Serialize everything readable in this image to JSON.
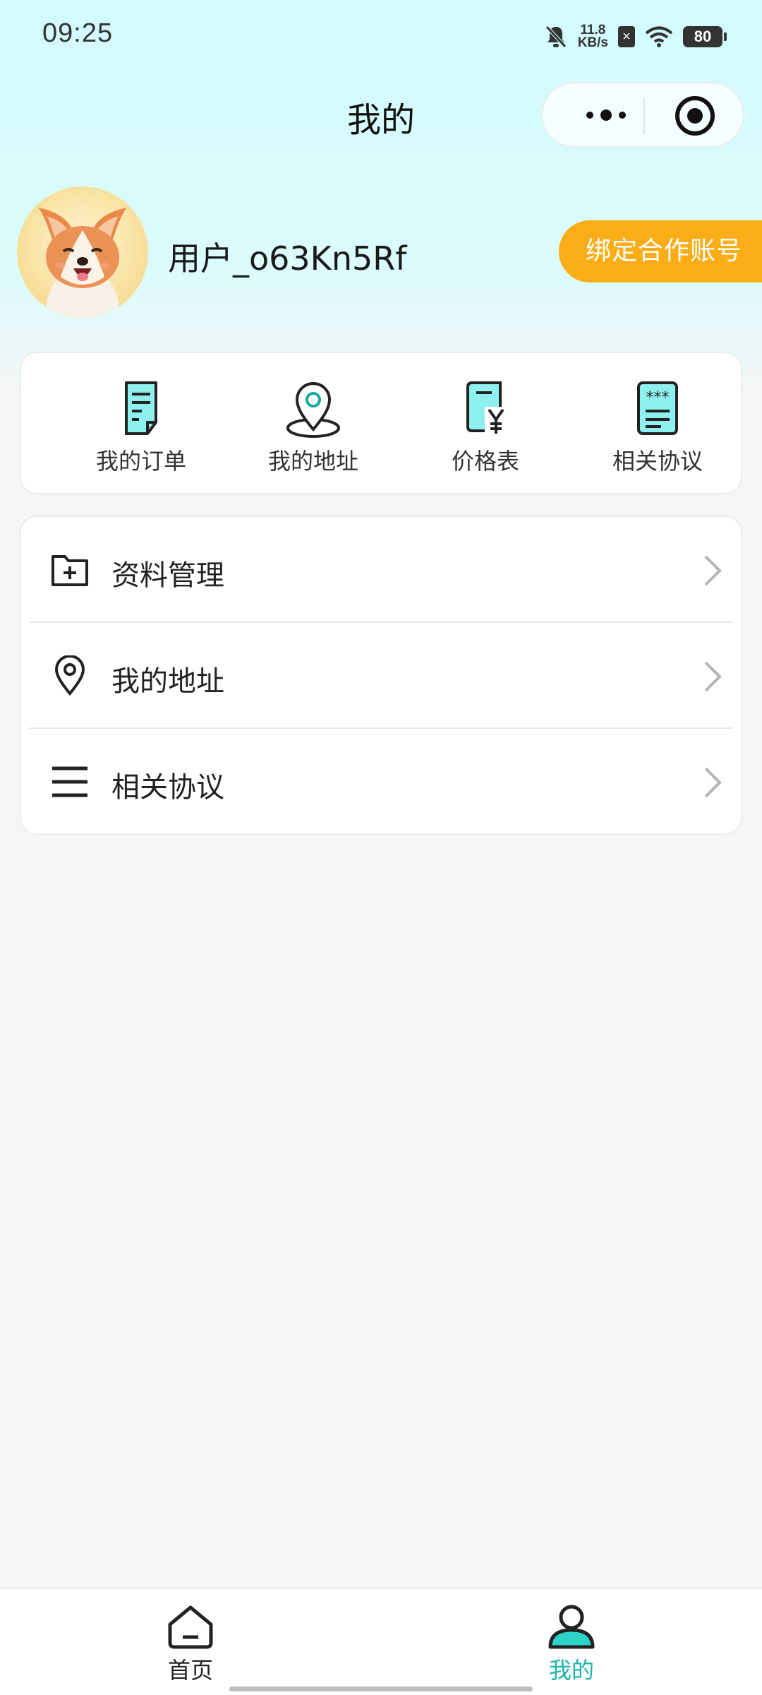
{
  "status_bar": {
    "time": "09:25",
    "net_speed_value": "11.8",
    "net_speed_unit": "KB/s",
    "battery": "80",
    "icons": [
      "bell-off-icon",
      "sim-off-icon",
      "wifi-icon",
      "battery-icon"
    ]
  },
  "header": {
    "title": "我的",
    "capsule_icons": [
      "more-icon",
      "close-target-icon"
    ]
  },
  "profile": {
    "username": "用户_o63Kn5Rf",
    "bind_button": "绑定合作账号",
    "avatar_icon": "corgi-avatar"
  },
  "quick_actions": [
    {
      "label": "我的订单",
      "icon": "order-icon"
    },
    {
      "label": "我的地址",
      "icon": "location-icon"
    },
    {
      "label": "价格表",
      "icon": "price-list-icon"
    },
    {
      "label": "相关协议",
      "icon": "agreement-icon"
    }
  ],
  "menu": [
    {
      "label": "资料管理",
      "icon": "folder-add-icon"
    },
    {
      "label": "我的地址",
      "icon": "location-pin-icon"
    },
    {
      "label": "相关协议",
      "icon": "menu-lines-icon"
    }
  ],
  "tab_bar": {
    "tabs": [
      {
        "label": "首页",
        "icon": "home-icon",
        "active": false
      },
      {
        "label": "我的",
        "icon": "user-icon",
        "active": true
      }
    ]
  },
  "colors": {
    "accent_teal": "#1cb3a8",
    "icon_fill": "#8ff0f0",
    "bind_button_orange": "#fbad18",
    "header_bg": "#d2fbfd"
  }
}
